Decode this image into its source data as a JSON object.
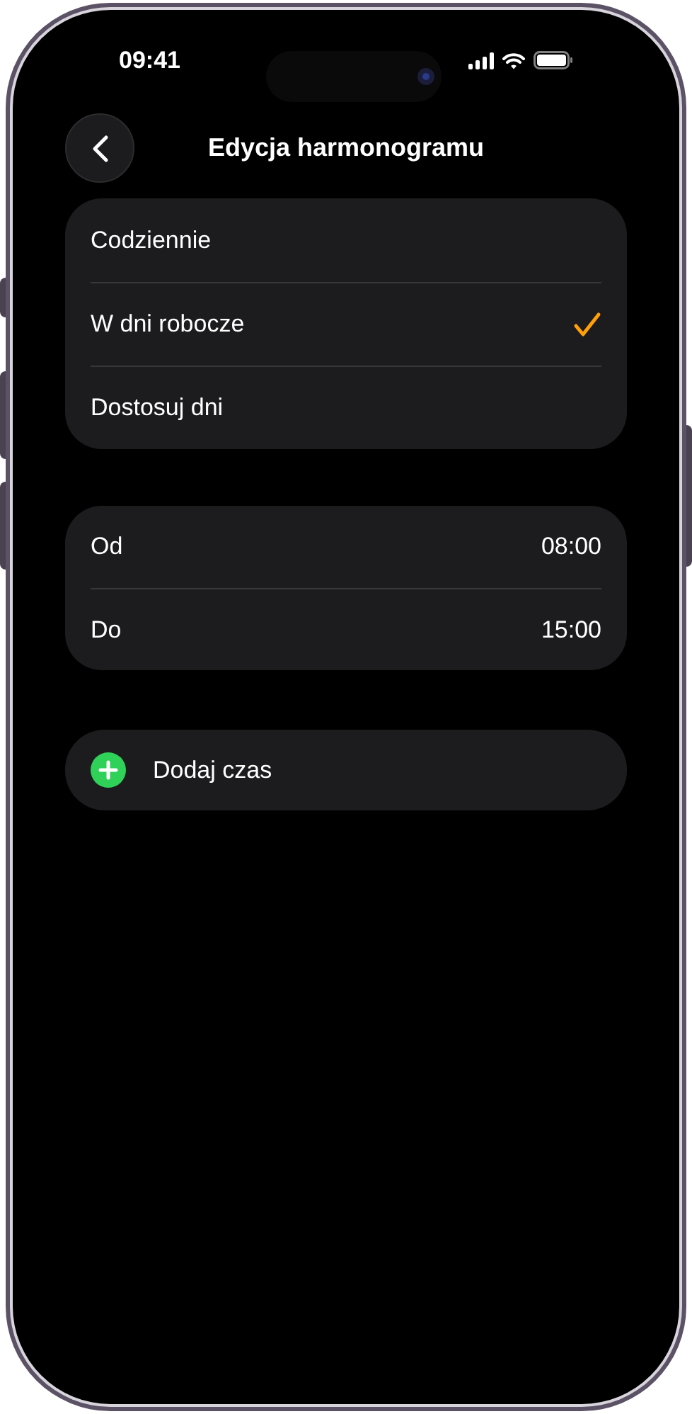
{
  "status_bar": {
    "time": "09:41"
  },
  "nav": {
    "title": "Edycja harmonogramu"
  },
  "repeat_options": [
    {
      "label": "Codziennie",
      "selected": false
    },
    {
      "label": "W dni robocze",
      "selected": true
    },
    {
      "label": "Dostosuj dni",
      "selected": false
    }
  ],
  "time_rows": [
    {
      "label": "Od",
      "value": "08:00"
    },
    {
      "label": "Do",
      "value": "15:00"
    }
  ],
  "add_button": {
    "label": "Dodaj czas"
  }
}
